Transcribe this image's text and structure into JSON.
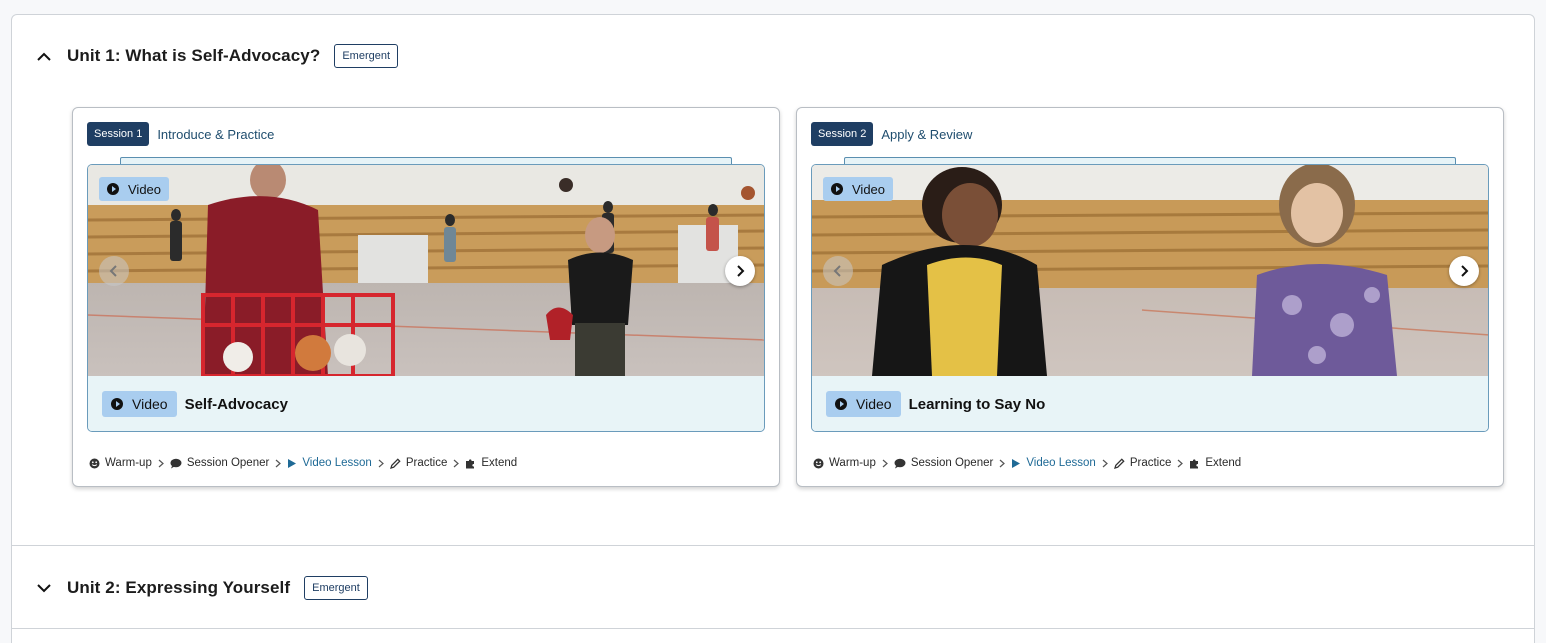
{
  "units": [
    {
      "title": "Unit 1: What is Self-Advocacy?",
      "badge": "Emergent",
      "expanded": true,
      "sessions": [
        {
          "pill": "Session 1",
          "name": "Introduce & Practice",
          "photo_tag": "Video",
          "caption_tag": "Video",
          "caption_title": "Self-Advocacy"
        },
        {
          "pill": "Session 2",
          "name": "Apply & Review",
          "photo_tag": "Video",
          "caption_tag": "Video",
          "caption_title": "Learning to Say No"
        }
      ]
    },
    {
      "title": "Unit 2: Expressing Yourself",
      "badge": "Emergent",
      "expanded": false
    }
  ],
  "steps": [
    {
      "label": "Warm-up",
      "icon": "smiley-icon",
      "active": false
    },
    {
      "label": "Session Opener",
      "icon": "speech-bubble-icon",
      "active": false
    },
    {
      "label": "Video Lesson",
      "icon": "play-icon",
      "active": true
    },
    {
      "label": "Practice",
      "icon": "pencil-icon",
      "active": false
    },
    {
      "label": "Extend",
      "icon": "puzzle-icon",
      "active": false
    }
  ],
  "colors": {
    "navy": "#1f3e63",
    "active_link": "#1f6a96",
    "video_tag": "#a9cdef",
    "caption_bg": "#e8f4f7"
  }
}
